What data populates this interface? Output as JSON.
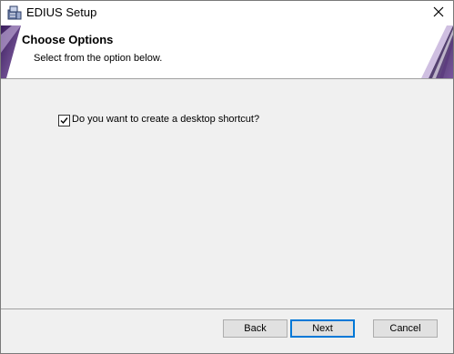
{
  "window": {
    "title": "EDIUS Setup"
  },
  "banner": {
    "heading": "Choose Options",
    "subheading": "Select from the option below."
  },
  "options": {
    "desktop_shortcut": {
      "label": "Do you want to create a desktop shortcut?",
      "checked": true
    }
  },
  "buttons": {
    "back": "Back",
    "next": "Next",
    "cancel": "Cancel"
  },
  "colors": {
    "accent": "#6b3a8c",
    "focus": "#0078d7"
  },
  "icons": {
    "app": "installer-icon",
    "close": "close-icon",
    "check": "checkmark-icon"
  }
}
